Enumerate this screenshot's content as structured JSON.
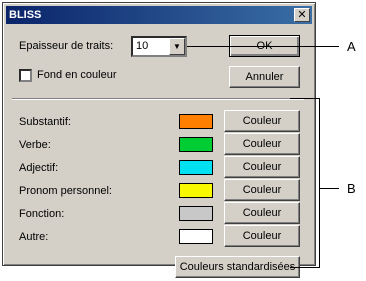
{
  "window": {
    "title": "BLISS",
    "close_glyph": "✕"
  },
  "line_thickness": {
    "label": "Epaisseur de traits:",
    "value": "10"
  },
  "background_checkbox": {
    "label": "Fond en couleur",
    "checked": false
  },
  "buttons": {
    "ok": "OK",
    "cancel": "Annuler",
    "standard_colors": "Couleurs standardisées"
  },
  "color_rows": [
    {
      "label": "Substantif:",
      "swatch": "#ff8000",
      "button": "Couleur"
    },
    {
      "label": "Verbe:",
      "swatch": "#00cc33",
      "button": "Couleur"
    },
    {
      "label": "Adjectif:",
      "swatch": "#00e0f0",
      "button": "Couleur"
    },
    {
      "label": "Pronom personnel:",
      "swatch": "#f8f800",
      "button": "Couleur"
    },
    {
      "label": "Fonction:",
      "swatch": "#c8c8c8",
      "button": "Couleur"
    },
    {
      "label": "Autre:",
      "swatch": "#ffffff",
      "button": "Couleur"
    }
  ],
  "callouts": {
    "a": "A",
    "b": "B"
  }
}
